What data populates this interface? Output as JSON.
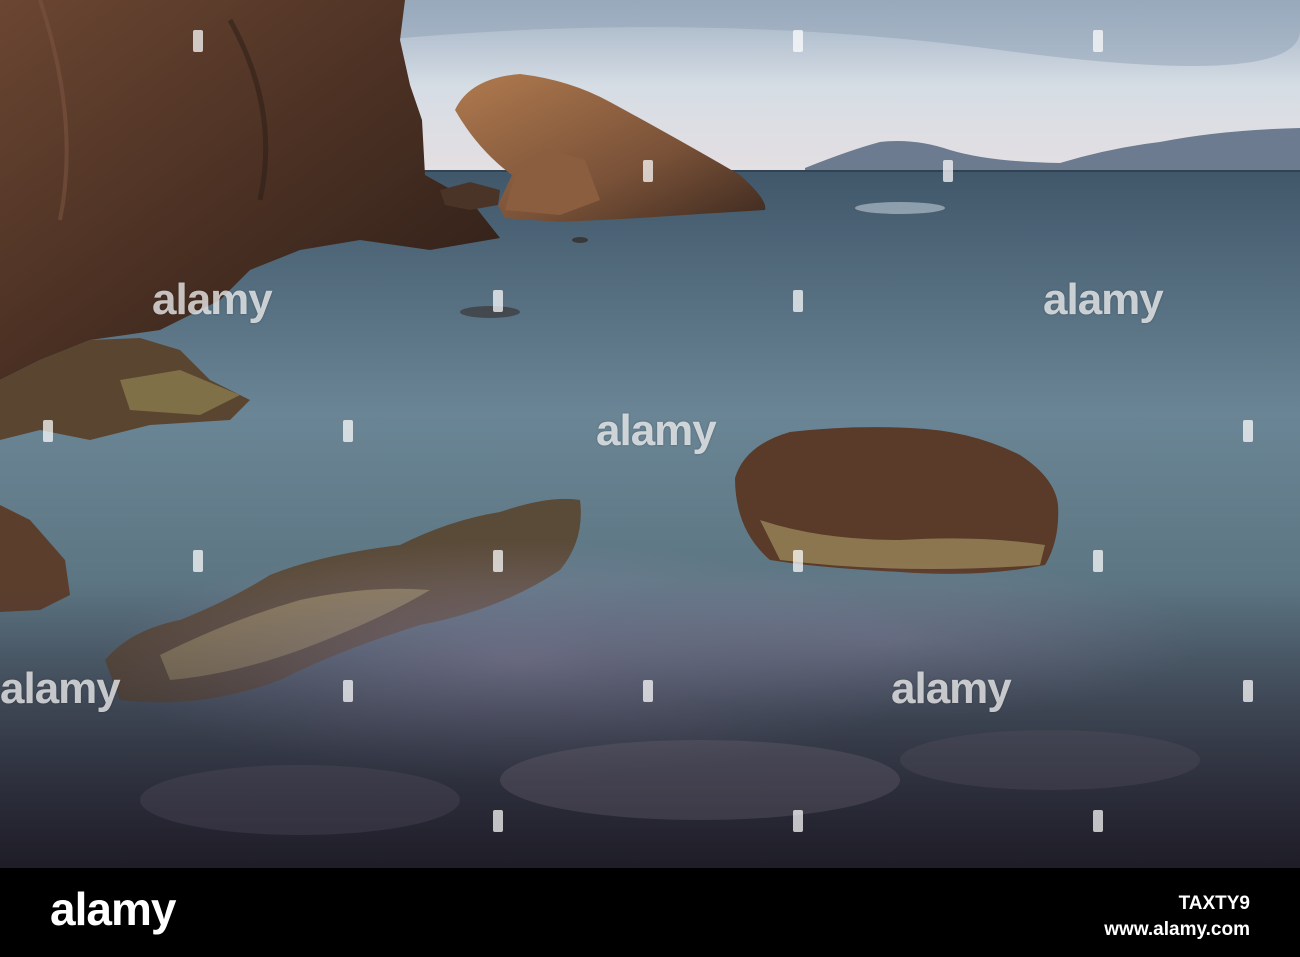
{
  "watermark": {
    "text": "alamy"
  },
  "footer": {
    "logo": "alamy",
    "image_id": "TAXTY9",
    "url": "www.alamy.com"
  },
  "colors": {
    "sky": "#c8d2dc",
    "sea": "#6b8190",
    "rock": "#5a3a28",
    "footer_bg": "#000000"
  }
}
